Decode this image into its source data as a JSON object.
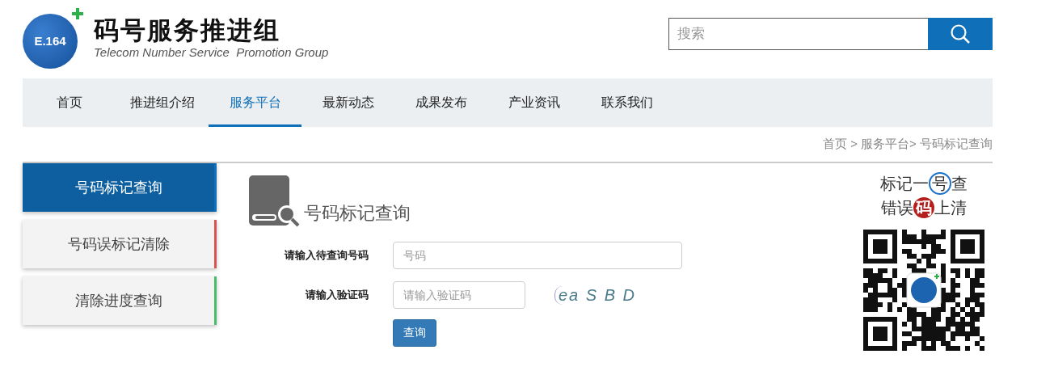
{
  "header": {
    "logo_text": "E.164",
    "title": "码号服务推进组",
    "subtitle": "Telecom Number Service  Promotion Group"
  },
  "search": {
    "placeholder": "搜索"
  },
  "nav": [
    {
      "label": "首页",
      "selected": false
    },
    {
      "label": "推进组介绍",
      "selected": false
    },
    {
      "label": "服务平台",
      "selected": true
    },
    {
      "label": "最新动态",
      "selected": false
    },
    {
      "label": "成果发布",
      "selected": false
    },
    {
      "label": "产业资讯",
      "selected": false
    },
    {
      "label": "联系我们",
      "selected": false
    }
  ],
  "breadcrumb": "首页 > 服务平台> 号码标记查询",
  "sidebar": [
    {
      "label": "号码标记查询",
      "selected": true,
      "color": "#0f6fb8"
    },
    {
      "label": "号码误标记清除",
      "selected": false,
      "color": "#d9534f"
    },
    {
      "label": "清除进度查询",
      "selected": false,
      "color": "#4cbb6c"
    }
  ],
  "form": {
    "title": "号码标记查询",
    "fields": [
      {
        "label": "请输入待查询号码",
        "placeholder": "号码",
        "kind": "wide"
      },
      {
        "label": "请输入验证码",
        "placeholder": "请输入验证码",
        "kind": "captcha"
      }
    ],
    "captcha": "ea S B D",
    "submit": "查询"
  },
  "promo": {
    "line_1": [
      "标记一",
      "号",
      "查"
    ],
    "line_2": [
      "错误",
      "码",
      "上清"
    ]
  }
}
